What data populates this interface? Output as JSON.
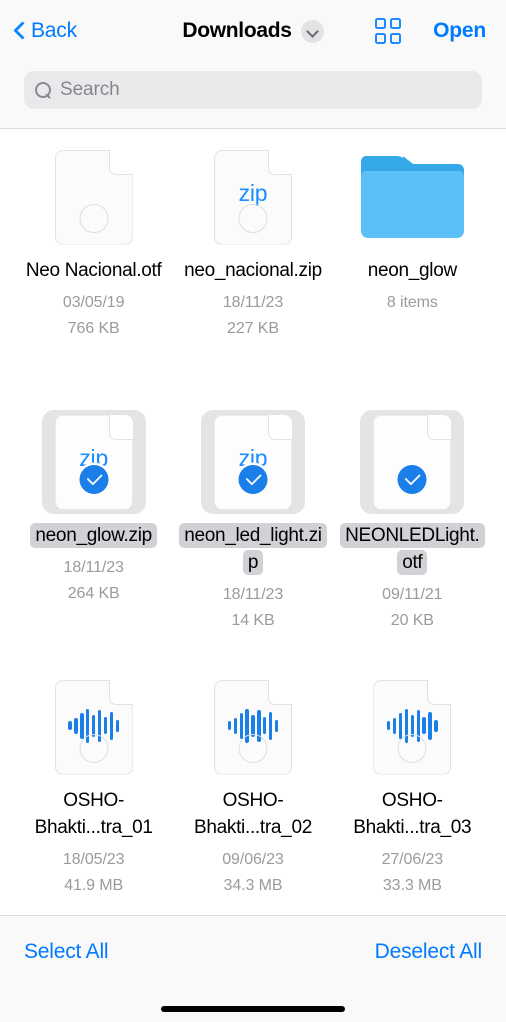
{
  "header": {
    "back_label": "Back",
    "title": "Downloads",
    "open_label": "Open",
    "accent_color": "#007aff"
  },
  "search": {
    "placeholder": "Search",
    "value": ""
  },
  "files": [
    {
      "name": "Neo Nacional.otf",
      "kind": "document",
      "badge": "",
      "date": "03/05/19",
      "size": "766 KB",
      "selected": false
    },
    {
      "name": "neo_nacional.zip",
      "kind": "document",
      "badge": "zip",
      "date": "18/11/23",
      "size": "227 KB",
      "selected": false
    },
    {
      "name": "neon_glow",
      "kind": "folder",
      "badge": "",
      "date": "8 items",
      "size": "",
      "selected": false
    },
    {
      "name": "neon_glow.zip",
      "kind": "document",
      "badge": "zip",
      "date": "18/11/23",
      "size": "264 KB",
      "selected": true
    },
    {
      "name": "neon_led_light.zip",
      "kind": "document",
      "badge": "zip",
      "date": "18/11/23",
      "size": "14 KB",
      "selected": true
    },
    {
      "name": "NEONLEDLight.otf",
      "kind": "document",
      "badge": "",
      "date": "09/11/21",
      "size": "20 KB",
      "selected": true
    },
    {
      "name": "OSHO-Bhakti...tra_01",
      "kind": "audio",
      "badge": "",
      "date": "18/05/23",
      "size": "41.9 MB",
      "selected": false
    },
    {
      "name": "OSHO-Bhakti...tra_02",
      "kind": "audio",
      "badge": "",
      "date": "09/06/23",
      "size": "34.3 MB",
      "selected": false
    },
    {
      "name": "OSHO-Bhakti...tra_03",
      "kind": "audio",
      "badge": "",
      "date": "27/06/23",
      "size": "33.3 MB",
      "selected": false
    }
  ],
  "bottom_bar": {
    "select_all_label": "Select All",
    "deselect_all_label": "Deselect All"
  },
  "icons": {
    "back": "chevron-left-icon",
    "title_menu": "chevron-down-icon",
    "view_mode": "grid-view-icon",
    "search": "search-icon",
    "selected": "check-circle-icon",
    "unselected": "empty-circle-icon"
  }
}
